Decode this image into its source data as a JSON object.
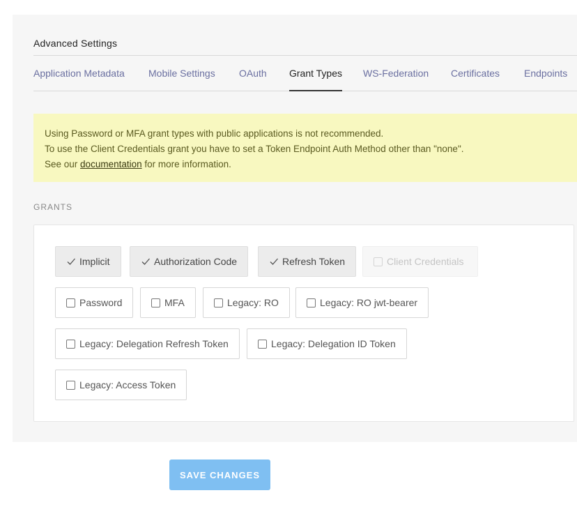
{
  "section_title": "Advanced Settings",
  "tabs": [
    {
      "label": "Application Metadata",
      "active": false
    },
    {
      "label": "Mobile Settings",
      "active": false
    },
    {
      "label": "OAuth",
      "active": false
    },
    {
      "label": "Grant Types",
      "active": true
    },
    {
      "label": "WS-Federation",
      "active": false
    },
    {
      "label": "Certificates",
      "active": false
    },
    {
      "label": "Endpoints",
      "active": false
    }
  ],
  "alert": {
    "line1": "Using Password or MFA grant types with public applications is not recommended.",
    "line2": "To use the Client Credentials grant you have to set a Token Endpoint Auth Method other than \"none\".",
    "line3_prefix": "See our ",
    "line3_link": "documentation",
    "line3_suffix": " for more information."
  },
  "grants": {
    "label": "GRANTS",
    "items": [
      {
        "label": "Implicit",
        "checked": true,
        "disabled": false
      },
      {
        "label": "Authorization Code",
        "checked": true,
        "disabled": false
      },
      {
        "label": "Refresh Token",
        "checked": true,
        "disabled": false
      },
      {
        "label": "Client Credentials",
        "checked": false,
        "disabled": true
      },
      {
        "label": "Password",
        "checked": false,
        "disabled": false
      },
      {
        "label": "MFA",
        "checked": false,
        "disabled": false
      },
      {
        "label": "Legacy: RO",
        "checked": false,
        "disabled": false
      },
      {
        "label": "Legacy: RO jwt-bearer",
        "checked": false,
        "disabled": false
      },
      {
        "label": "Legacy: Delegation Refresh Token",
        "checked": false,
        "disabled": false
      },
      {
        "label": "Legacy: Delegation ID Token",
        "checked": false,
        "disabled": false
      },
      {
        "label": "Legacy: Access Token",
        "checked": false,
        "disabled": false
      }
    ]
  },
  "save_button": "SAVE CHANGES",
  "colors": {
    "tab_link": "#6a6fa0",
    "alert_bg": "#f8f8c0",
    "save_button_bg": "#7fbff2"
  }
}
